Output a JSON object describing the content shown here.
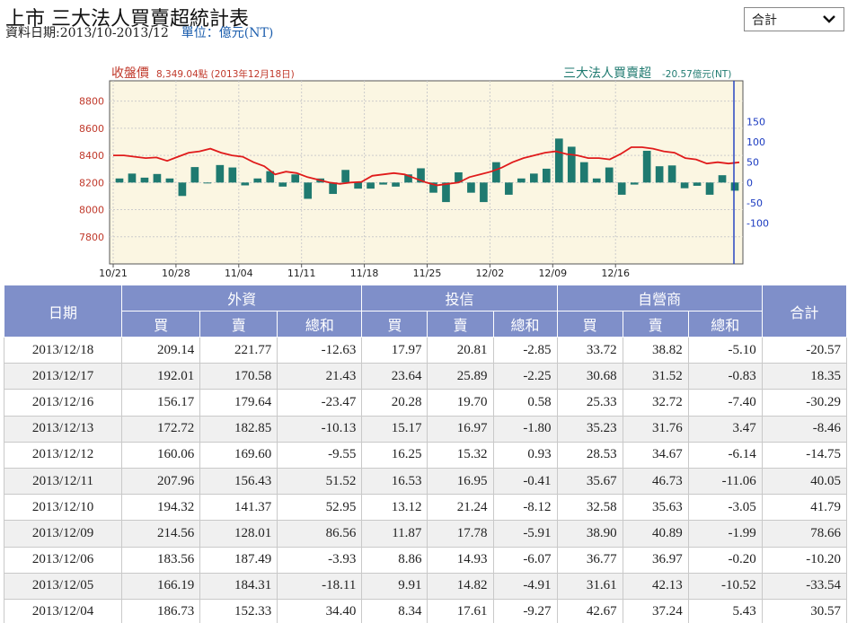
{
  "page": {
    "title": "上市 三大法人買賣超統計表",
    "date_range": "資料日期:2013/10-2013/12",
    "unit": "單位：億元(NT)"
  },
  "dropdown": {
    "selected": "合計",
    "icon": "chevron-down-icon"
  },
  "chart_data": {
    "type": "bar+line",
    "left_label": "收盤價",
    "left_value_label": "8,349.04點 (2013年12月18日)",
    "right_label": "三大法人買賣超",
    "right_value_label": "-20.57億元(NT)",
    "left_axis": {
      "ylim": [
        7600,
        8950
      ],
      "ticks": [
        "8800",
        "8600",
        "8400",
        "8200",
        "8000",
        "7800"
      ],
      "tick_values": [
        8800,
        8600,
        8400,
        8200,
        8000,
        7800
      ]
    },
    "right_axis": {
      "ylim": [
        -200,
        250
      ],
      "ticks": [
        "150",
        "100",
        "50",
        "0",
        "-50",
        "-100"
      ],
      "tick_values": [
        150,
        100,
        50,
        0,
        -50,
        -100
      ]
    },
    "x_ticks": [
      "10/21",
      "10/28",
      "11/04",
      "11/11",
      "11/18",
      "11/25",
      "12/02",
      "12/09",
      "12/16"
    ],
    "x_tick_index": [
      0,
      5,
      10,
      15,
      20,
      25,
      30,
      35,
      40
    ],
    "net_buy_sell": [
      10,
      22,
      12,
      21,
      10,
      -33,
      38,
      0,
      43,
      37,
      -7,
      10,
      28,
      -10,
      20,
      -40,
      10,
      -28,
      31,
      -15,
      -15,
      -5,
      -10,
      20,
      35,
      -25,
      -48,
      25,
      -25,
      -48,
      50,
      -30,
      10,
      22,
      34,
      108,
      88,
      50,
      10,
      37,
      -30,
      -5,
      78,
      40,
      42,
      -14,
      -8,
      -30,
      18,
      -20
    ],
    "net_buy_sell_display_note": "",
    "close_price": [
      8400,
      8400,
      8390,
      8380,
      8385,
      8360,
      8390,
      8420,
      8430,
      8450,
      8420,
      8400,
      8390,
      8350,
      8320,
      8260,
      8280,
      8270,
      8240,
      8220,
      8200,
      8190,
      8200,
      8205,
      8250,
      8260,
      8270,
      8260,
      8230,
      8200,
      8180,
      8190,
      8200,
      8240,
      8260,
      8280,
      8310,
      8350,
      8380,
      8400,
      8420,
      8430,
      8410,
      8400,
      8380,
      8380,
      8370,
      8410,
      8460,
      8460,
      8450,
      8430,
      8420,
      8380,
      8370,
      8340,
      8350,
      8340,
      8349
    ],
    "colors": {
      "bar": "#1f7a70",
      "line": "#e01b1b",
      "left_axis": "#c0392b",
      "right_axis": "#1a3ac0",
      "plot_bg": "#fbf6e2"
    }
  },
  "table": {
    "headers": {
      "date": "日期",
      "foreign": "外資",
      "trust": "投信",
      "dealer": "自營商",
      "total": "合計",
      "buy": "買",
      "sell": "賣",
      "net": "總和"
    },
    "rows": [
      [
        "2013/12/18",
        "209.14",
        "221.77",
        "-12.63",
        "17.97",
        "20.81",
        "-2.85",
        "33.72",
        "38.82",
        "-5.10",
        "-20.57"
      ],
      [
        "2013/12/17",
        "192.01",
        "170.58",
        "21.43",
        "23.64",
        "25.89",
        "-2.25",
        "30.68",
        "31.52",
        "-0.83",
        "18.35"
      ],
      [
        "2013/12/16",
        "156.17",
        "179.64",
        "-23.47",
        "20.28",
        "19.70",
        "0.58",
        "25.33",
        "32.72",
        "-7.40",
        "-30.29"
      ],
      [
        "2013/12/13",
        "172.72",
        "182.85",
        "-10.13",
        "15.17",
        "16.97",
        "-1.80",
        "35.23",
        "31.76",
        "3.47",
        "-8.46"
      ],
      [
        "2013/12/12",
        "160.06",
        "169.60",
        "-9.55",
        "16.25",
        "15.32",
        "0.93",
        "28.53",
        "34.67",
        "-6.14",
        "-14.75"
      ],
      [
        "2013/12/11",
        "207.96",
        "156.43",
        "51.52",
        "16.53",
        "16.95",
        "-0.41",
        "35.67",
        "46.73",
        "-11.06",
        "40.05"
      ],
      [
        "2013/12/10",
        "194.32",
        "141.37",
        "52.95",
        "13.12",
        "21.24",
        "-8.12",
        "32.58",
        "35.63",
        "-3.05",
        "41.79"
      ],
      [
        "2013/12/09",
        "214.56",
        "128.01",
        "86.56",
        "11.87",
        "17.78",
        "-5.91",
        "38.90",
        "40.89",
        "-1.99",
        "78.66"
      ],
      [
        "2013/12/06",
        "183.56",
        "187.49",
        "-3.93",
        "8.86",
        "14.93",
        "-6.07",
        "36.77",
        "36.97",
        "-0.20",
        "-10.20"
      ],
      [
        "2013/12/05",
        "166.19",
        "184.31",
        "-18.11",
        "9.91",
        "14.82",
        "-4.91",
        "31.61",
        "42.13",
        "-10.52",
        "-33.54"
      ],
      [
        "2013/12/04",
        "186.73",
        "152.33",
        "34.40",
        "8.34",
        "17.61",
        "-9.27",
        "42.67",
        "37.24",
        "5.43",
        "30.57"
      ]
    ]
  }
}
